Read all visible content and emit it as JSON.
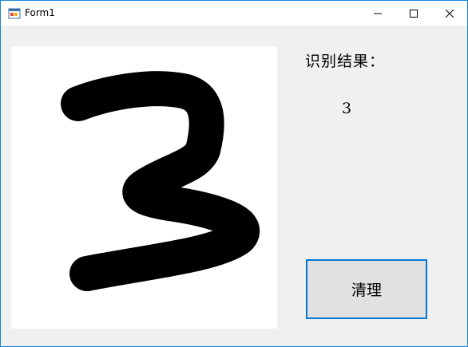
{
  "window": {
    "title": "Form1",
    "controls": {
      "minimize_icon": "minimize-icon",
      "maximize_icon": "maximize-icon",
      "close_icon": "close-icon"
    },
    "accent_color": "#1883d7"
  },
  "canvas": {
    "content_description_icon": "handwritten-digit-drawing",
    "stroke_color": "#000000",
    "background_color": "#ffffff"
  },
  "result": {
    "label": "识别结果：",
    "value": "3"
  },
  "buttons": {
    "clear_label": "清理"
  }
}
